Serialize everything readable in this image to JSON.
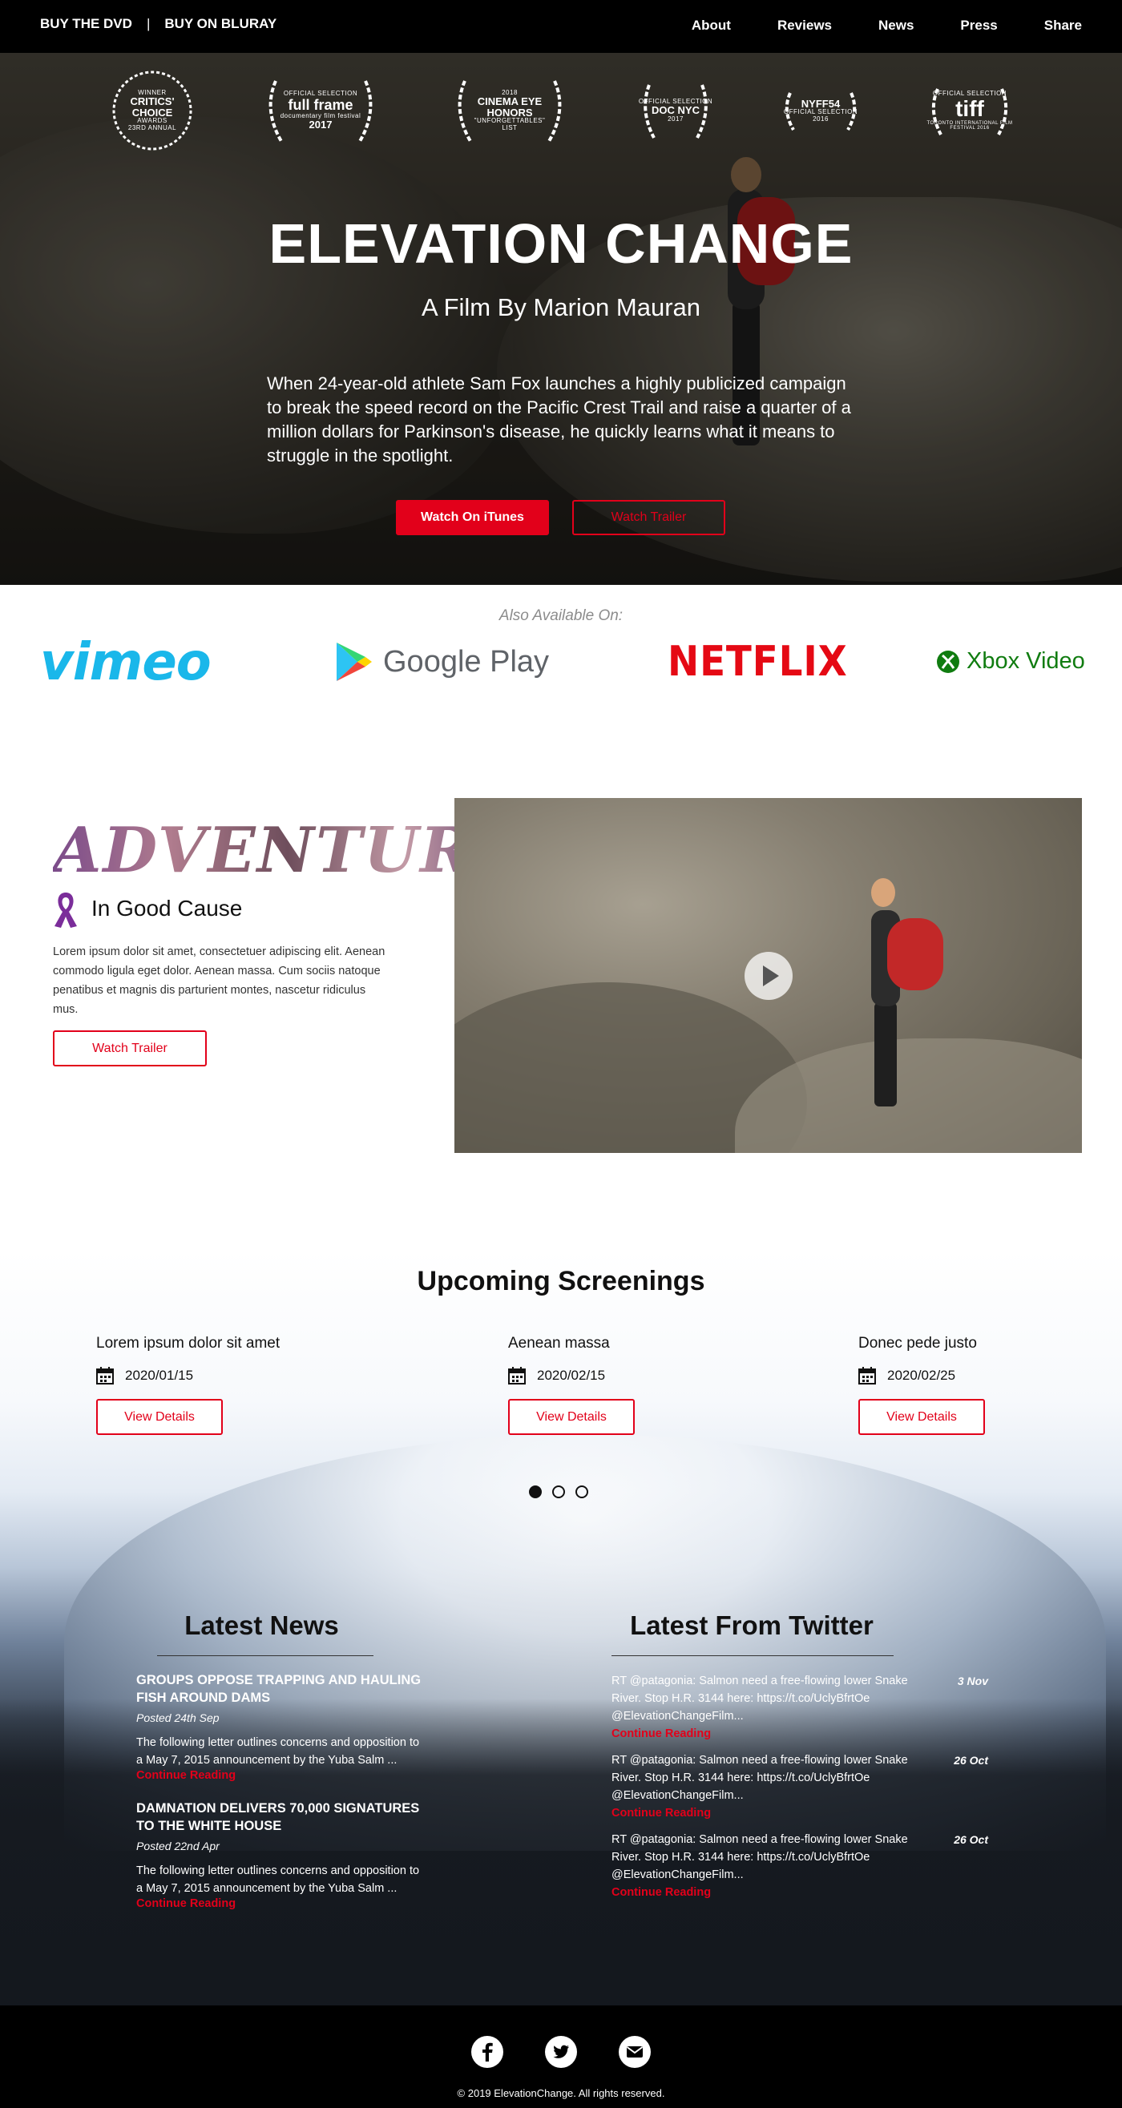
{
  "nav": {
    "left": [
      "BUY THE DVD",
      "BUY ON BLURAY"
    ],
    "separator": "|",
    "right": [
      "About",
      "Reviews",
      "News",
      "Press",
      "Share"
    ]
  },
  "hero": {
    "laurels": [
      {
        "small": "WINNER",
        "big": "CRITICS' CHOICE",
        "mid": "AWARDS",
        "foot": "23RD ANNUAL"
      },
      {
        "small": "OFFICIAL SELECTION",
        "big": "full frame",
        "mid": "documentary film festival",
        "foot": "2017"
      },
      {
        "small": "2018",
        "big": "CINEMA EYE HONORS",
        "mid": "",
        "foot": "\"UNFORGETTABLES\" LIST"
      },
      {
        "small": "OFFICIAL SELECTION",
        "big": "DOC NYC",
        "mid": "",
        "foot": "2017"
      },
      {
        "small": "",
        "big": "NYFF54",
        "mid": "",
        "foot": "OFFICIAL SELECTION 2016"
      },
      {
        "small": "OFFICIAL SELECTION",
        "big": "tiff",
        "mid": "",
        "foot": "TORONTO INTERNATIONAL FILM FESTIVAL 2016"
      }
    ],
    "title": "ELEVATION CHANGE",
    "subtitle": "A Film By Marion Mauran",
    "description": "When 24-year-old athlete Sam Fox launches a highly publicized campaign to break the speed record on the Pacific Crest Trail and raise a quarter of a million dollars for Parkinson's disease, he quickly learns what it means to struggle in the spotlight.",
    "primary_button": "Watch On iTunes",
    "secondary_button": "Watch Trailer"
  },
  "available": {
    "label": "Also Available On:",
    "platforms": [
      "vimeo",
      "Google Play",
      "NETFLIX",
      "Xbox Video"
    ]
  },
  "adventure": {
    "title": "ADVENTURE",
    "cause": "In Good Cause",
    "text": "Lorem ipsum dolor sit amet, consectetuer adipiscing elit. Aenean commodo ligula eget dolor. Aenean massa. Cum sociis natoque penatibus et magnis dis parturient montes, nascetur ridiculus mus.",
    "button": "Watch Trailer"
  },
  "screenings": {
    "title": "Upcoming Screenings",
    "items": [
      {
        "name": "Lorem ipsum dolor sit amet",
        "date": "2020/01/15",
        "button": "View Details"
      },
      {
        "name": "Aenean massa",
        "date": "2020/02/15",
        "button": "View Details"
      },
      {
        "name": "Donec pede justo",
        "date": "2020/02/25",
        "button": "View Details"
      }
    ]
  },
  "news": {
    "title": "Latest News",
    "items": [
      {
        "headline": "GROUPS OPPOSE TRAPPING AND HAULING FISH AROUND DAMS",
        "date": "Posted 24th Sep",
        "excerpt": "The following letter outlines concerns and opposition to a May 7, 2015 announcement by the Yuba Salm ...",
        "more": "Continue Reading"
      },
      {
        "headline": "DAMNATION DELIVERS 70,000 SIGNATURES TO THE WHITE HOUSE",
        "date": "Posted 22nd Apr",
        "excerpt": "The following letter outlines concerns and opposition to a May 7, 2015 announcement by the Yuba Salm ...",
        "more": "Continue Reading"
      }
    ]
  },
  "twitter": {
    "title": "Latest From Twitter",
    "items": [
      {
        "text": "RT @patagonia: Salmon need a free-flowing lower Snake River. Stop H.R. 3144 here: https://t.co/UclyBfrtOe @ElevationChangeFilm...",
        "date": "3 Nov",
        "more": "Continue Reading"
      },
      {
        "text": "RT @patagonia: Salmon need a free-flowing lower Snake River. Stop H.R. 3144 here: https://t.co/UclyBfrtOe @ElevationChangeFilm...",
        "date": "26 Oct",
        "more": "Continue Reading"
      },
      {
        "text": "RT @patagonia: Salmon need a free-flowing lower Snake River. Stop H.R. 3144 here: https://t.co/UclyBfrtOe @ElevationChangeFilm...",
        "date": "26 Oct",
        "more": "Continue Reading"
      }
    ]
  },
  "footer": {
    "social": [
      "facebook-icon",
      "twitter-icon",
      "email-icon"
    ],
    "copyright": "© 2019 ElevationChange. All rights reserved."
  },
  "colors": {
    "accent": "#e2001a",
    "nav_bg": "#000000",
    "vimeo": "#1ab7ea",
    "netflix": "#e50914",
    "xbox": "#107c10"
  }
}
